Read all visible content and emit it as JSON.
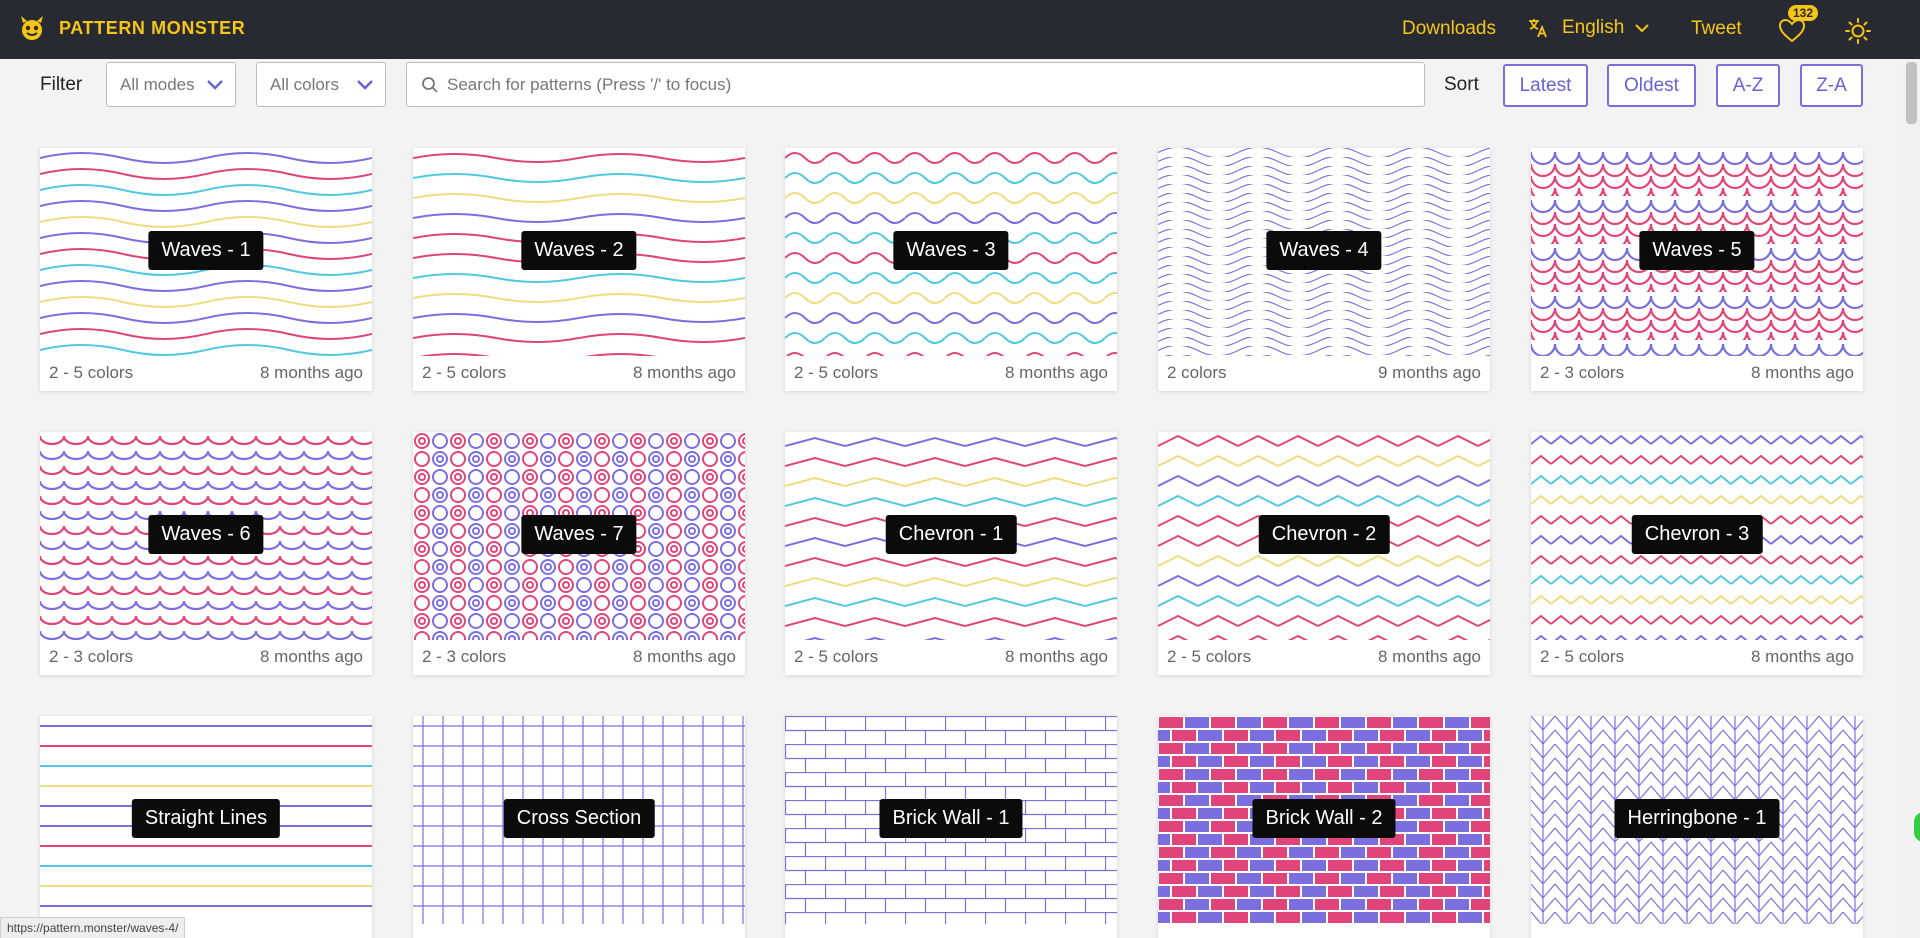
{
  "header": {
    "brand": "PATTERN MONSTER",
    "logo_icon": "monster-logo-icon",
    "downloads": "Downloads",
    "language": "English",
    "tweet": "Tweet",
    "likes_count": "132",
    "accent_color": "#f5c518",
    "background_color": "#282a32"
  },
  "filter": {
    "label": "Filter",
    "modes": "All modes",
    "colors": "All colors",
    "search_placeholder": "Search for patterns (Press '/' to focus)"
  },
  "sort": {
    "label": "Sort",
    "options": [
      "Latest",
      "Oldest",
      "A-Z",
      "Z-A"
    ],
    "accent_color": "#6a5fd6"
  },
  "patterns": [
    {
      "title": "Waves - 1",
      "colors": "2 - 5 colors",
      "age": "8 months ago"
    },
    {
      "title": "Waves - 2",
      "colors": "2 - 5 colors",
      "age": "8 months ago"
    },
    {
      "title": "Waves - 3",
      "colors": "2 - 5 colors",
      "age": "8 months ago"
    },
    {
      "title": "Waves - 4",
      "colors": "2 colors",
      "age": "9 months ago"
    },
    {
      "title": "Waves - 5",
      "colors": "2 - 3 colors",
      "age": "8 months ago"
    },
    {
      "title": "Waves - 6",
      "colors": "2 - 3 colors",
      "age": "8 months ago"
    },
    {
      "title": "Waves - 7",
      "colors": "2 - 3 colors",
      "age": "8 months ago"
    },
    {
      "title": "Chevron - 1",
      "colors": "2 - 5 colors",
      "age": "8 months ago"
    },
    {
      "title": "Chevron - 2",
      "colors": "2 - 5 colors",
      "age": "8 months ago"
    },
    {
      "title": "Chevron - 3",
      "colors": "2 - 5 colors",
      "age": "8 months ago"
    },
    {
      "title": "Straight Lines",
      "colors": "",
      "age": ""
    },
    {
      "title": "Cross Section",
      "colors": "",
      "age": ""
    },
    {
      "title": "Brick Wall - 1",
      "colors": "",
      "age": ""
    },
    {
      "title": "Brick Wall - 2",
      "colors": "",
      "age": ""
    },
    {
      "title": "Herringbone - 1",
      "colors": "",
      "age": ""
    }
  ],
  "palette": {
    "purple": "#7b6fe0",
    "pink": "#e0447a",
    "cyan": "#4fc8e0",
    "yellow": "#f0dc80"
  },
  "status_url": "https://pattern.monster/waves-4/"
}
